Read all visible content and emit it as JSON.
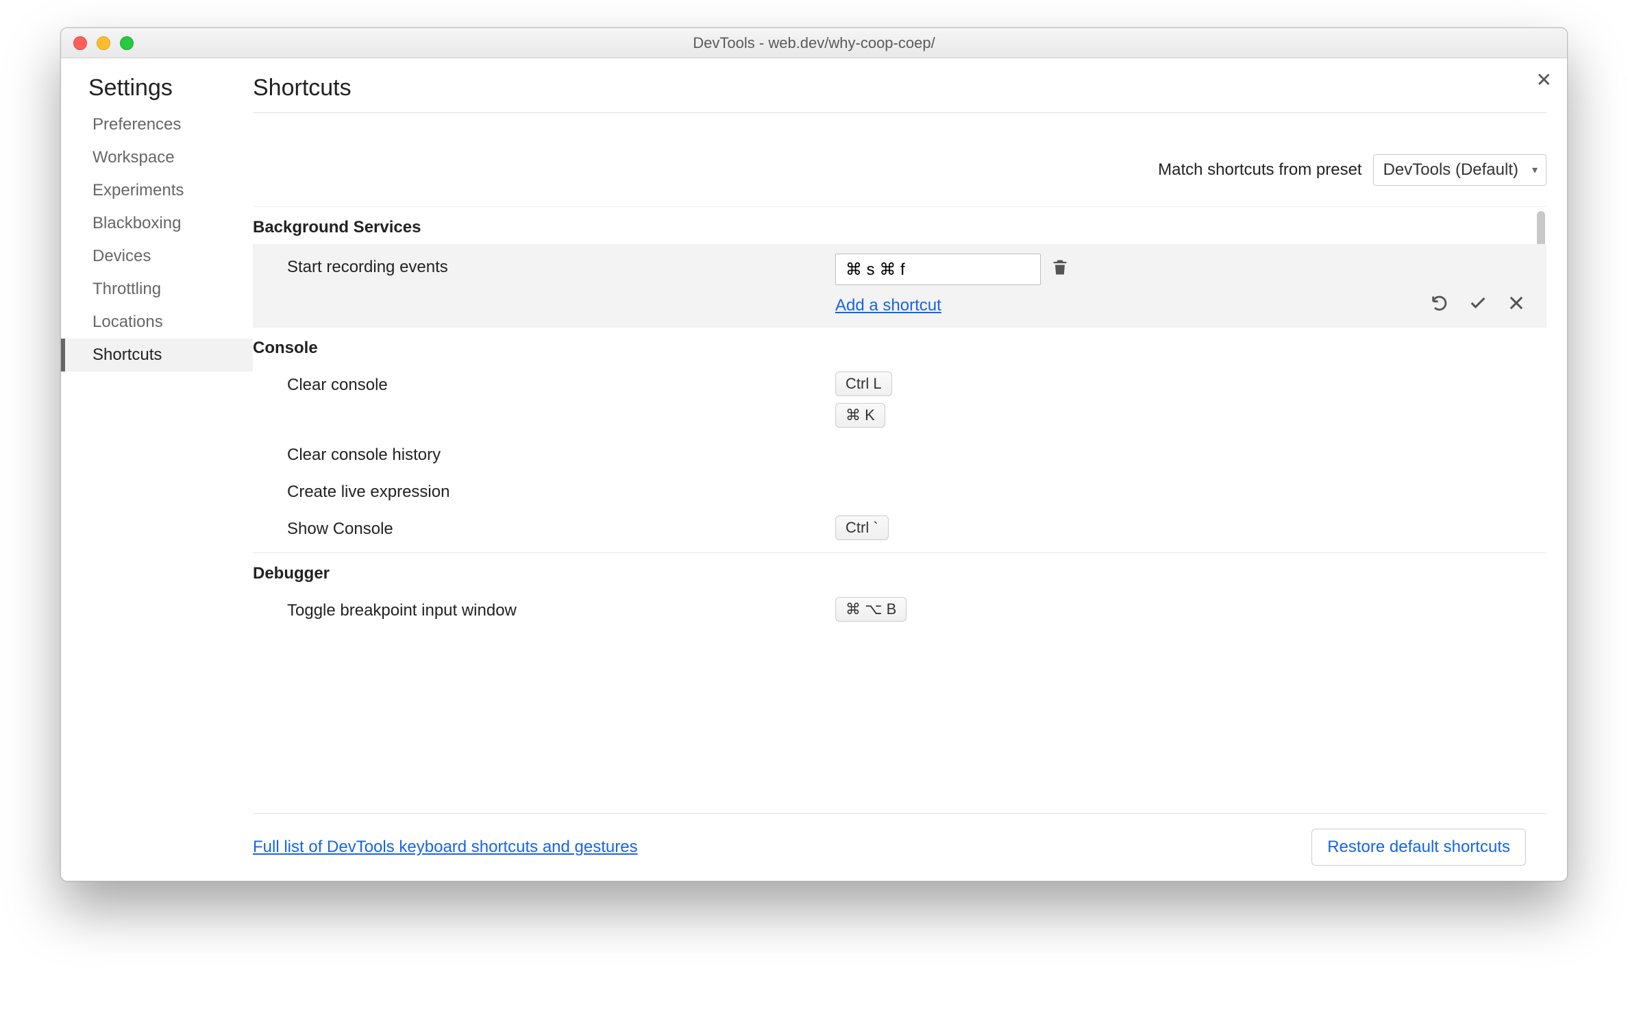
{
  "window": {
    "title": "DevTools - web.dev/why-coop-coep/"
  },
  "sidebar": {
    "title": "Settings",
    "items": [
      {
        "label": "Preferences"
      },
      {
        "label": "Workspace"
      },
      {
        "label": "Experiments"
      },
      {
        "label": "Blackboxing"
      },
      {
        "label": "Devices"
      },
      {
        "label": "Throttling"
      },
      {
        "label": "Locations"
      },
      {
        "label": "Shortcuts"
      }
    ],
    "active_index": 7
  },
  "main": {
    "title": "Shortcuts",
    "preset_label": "Match shortcuts from preset",
    "preset_value": "DevTools (Default)",
    "sections": {
      "bg_services": {
        "header": "Background Services",
        "row": {
          "label": "Start recording events",
          "input_value": "⌘ s ⌘ f",
          "add_link": "Add a shortcut"
        }
      },
      "console": {
        "header": "Console",
        "clear": {
          "label": "Clear console",
          "keys": [
            "Ctrl L",
            "⌘ K"
          ]
        },
        "clear_history": {
          "label": "Clear console history"
        },
        "live_expr": {
          "label": "Create live expression"
        },
        "show": {
          "label": "Show Console",
          "keys": [
            "Ctrl `"
          ]
        }
      },
      "debugger": {
        "header": "Debugger",
        "toggle": {
          "label": "Toggle breakpoint input window",
          "keys": [
            "⌘ ⌥ B"
          ]
        }
      }
    },
    "footer": {
      "link": "Full list of DevTools keyboard shortcuts and gestures",
      "restore": "Restore default shortcuts"
    }
  }
}
